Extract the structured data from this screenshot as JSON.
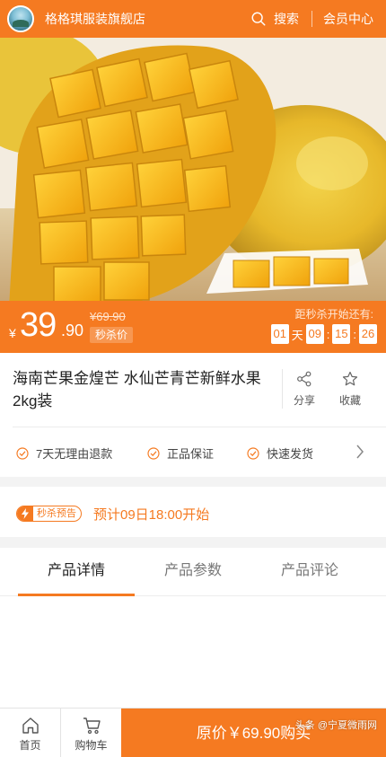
{
  "header": {
    "shop_name": "格格琪服装旗舰店",
    "search_label": "搜索",
    "member_label": "会员中心",
    "bg_color": "#f57a21"
  },
  "price": {
    "currency": "¥",
    "integer": "39",
    "decimal": ".90",
    "original": "¥69.90",
    "tag": "秒杀价",
    "countdown_label": "距秒杀开始还有:",
    "countdown": {
      "days": "01",
      "day_unit": "天",
      "hours": "09",
      "minutes": "15",
      "seconds": "26",
      "sep": ":"
    }
  },
  "product": {
    "title": "海南芒果金煌芒 水仙芒青芒新鲜水果 2kg装",
    "share_label": "分享",
    "fav_label": "收藏"
  },
  "guarantees": [
    "7天无理由退款",
    "正品保证",
    "快速发货"
  ],
  "preview": {
    "badge": "秒杀预告",
    "text": "预计09日18:00开始"
  },
  "tabs": [
    {
      "label": "产品详情",
      "active": true
    },
    {
      "label": "产品参数",
      "active": false
    },
    {
      "label": "产品评论",
      "active": false
    }
  ],
  "bottom": {
    "home_label": "首页",
    "cart_label": "购物车",
    "buy_label": "原价￥69.90购买",
    "watermark": "头条 @宁夏微雨网"
  }
}
